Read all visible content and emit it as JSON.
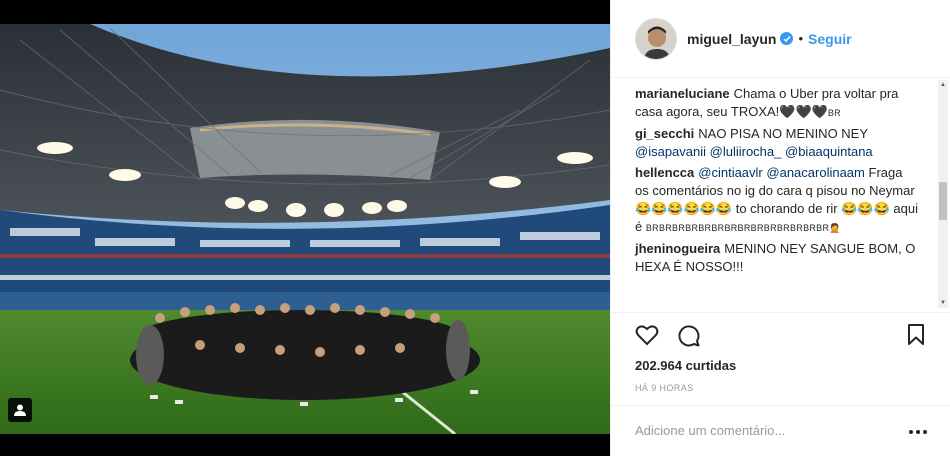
{
  "post": {
    "photo_icon": "tagged-users-icon"
  },
  "header": {
    "username": "miguel_layun",
    "separator": "•",
    "follow_label": "Seguir",
    "verified_icon": "verified-badge-icon"
  },
  "comments": [
    {
      "user": "marianeluciane",
      "text": "Chama o Uber pra voltar pra casa agora, seu TROXA!🖤🖤🖤",
      "suffix": "BR"
    },
    {
      "user": "gi_secchi",
      "text": "NAO PISA NO MENINO NEY ",
      "mentions": [
        "@isapavanii",
        "@luliirocha_",
        "@biaaquintana"
      ]
    },
    {
      "user": "hellencca",
      "mentions": [
        "@cintiaavlr",
        "@anacarolinaam"
      ],
      "text": "Fraga os comentários no ig do cara q pisou no Neymar 😂😂😂😂😂😂 to chorando de rir 😂😂😂 aqui é ",
      "suffix": "BRBRBRBRBRBRBRBRBRBRBRBRBRBR🤦"
    },
    {
      "user": "jheninogueira",
      "text": "MENINO NEY SANGUE BOM, O HEXA É NOSSO!!!"
    }
  ],
  "actions": {
    "like_icon": "heart-icon",
    "comment_icon": "comment-bubble-icon",
    "save_icon": "bookmark-icon"
  },
  "likes": "202.964 curtidas",
  "timestamp": "HÁ 9 HORAS",
  "add_comment": {
    "placeholder": "Adicione um comentário...",
    "more_icon": "more-options-icon"
  },
  "colors": {
    "link": "#3897f0",
    "mention": "#003569",
    "text": "#262626",
    "muted": "#999999"
  }
}
